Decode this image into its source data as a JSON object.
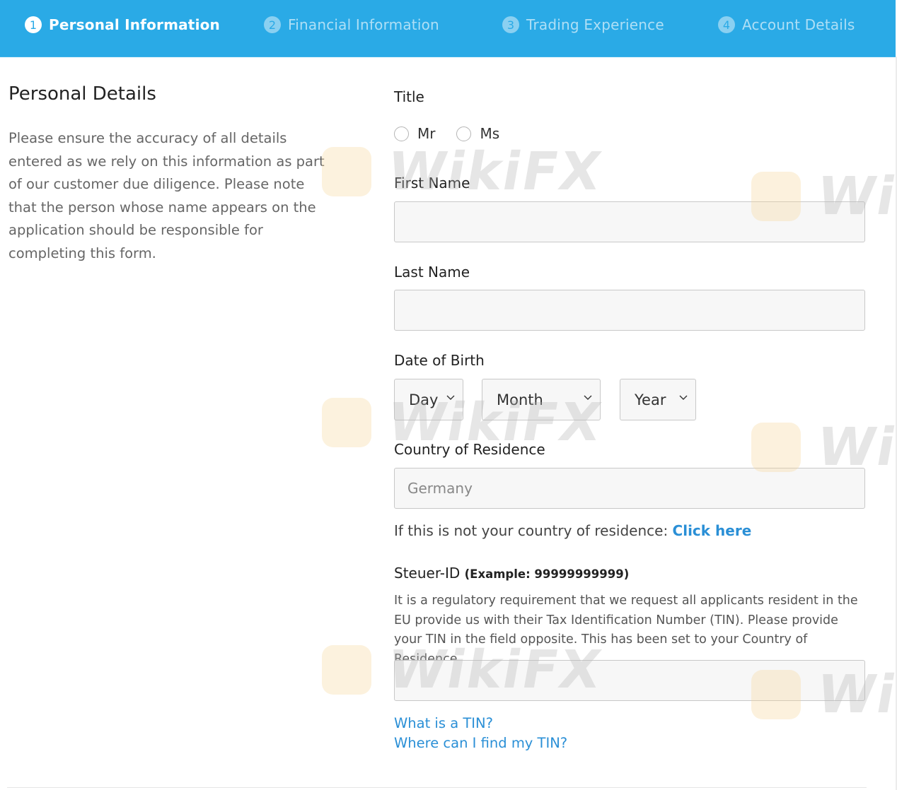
{
  "steps": [
    {
      "num": "1",
      "label": "Personal Information"
    },
    {
      "num": "2",
      "label": "Financial Information"
    },
    {
      "num": "3",
      "label": "Trading Experience"
    },
    {
      "num": "4",
      "label": "Account Details"
    }
  ],
  "section": {
    "title": "Personal Details",
    "description": "Please ensure the accuracy of all details entered as we rely on this information as part of our customer due diligence. Please note that the person whose name appears on the application should be responsible for completing this form."
  },
  "form": {
    "title_label": "Title",
    "title_options": [
      "Mr",
      "Ms"
    ],
    "first_name_label": "First Name",
    "last_name_label": "Last Name",
    "dob_label": "Date of Birth",
    "dob_day": "Day",
    "dob_month": "Month",
    "dob_year": "Year",
    "country_label": "Country of Residence",
    "country_value": "Germany",
    "country_note": "If this is not your country of residence: ",
    "country_link": "Click here",
    "tin_label": "Steuer-ID",
    "tin_example": "(Example: 99999999999)",
    "tin_description": "It is a regulatory requirement that we request all applicants resident in the EU provide us with their Tax Identification Number (TIN). Please provide your TIN in the field opposite. This has been set to your Country of Residence.",
    "tin_link_what": "What is a TIN?",
    "tin_link_where": "Where can I find my TIN?"
  },
  "watermark": {
    "text": "WikiFX"
  },
  "colors": {
    "header_bg": "#2aaae6",
    "link": "#2a8fd6"
  }
}
